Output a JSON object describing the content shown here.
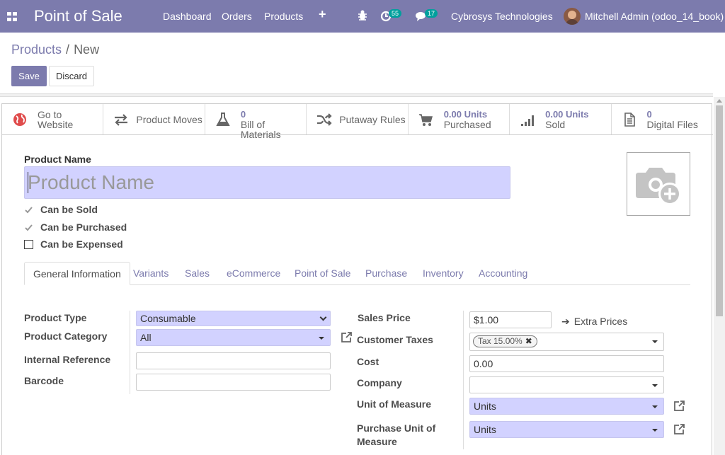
{
  "navbar": {
    "brand": "Point of Sale",
    "menu": [
      "Dashboard",
      "Orders",
      "Products"
    ],
    "plus": "+",
    "activity_badge": "55",
    "message_badge": "17",
    "company": "Cybrosys Technologies",
    "user": "Mitchell Admin (odoo_14_book)"
  },
  "breadcrumb": {
    "parent": "Products",
    "separator": "/",
    "current": "New"
  },
  "buttons": {
    "save": "Save",
    "discard": "Discard"
  },
  "smart_buttons": [
    {
      "icon": "globe-icon",
      "line1": "Go to",
      "line2": "Website"
    },
    {
      "icon": "exchange-icon",
      "label": "Product Moves"
    },
    {
      "icon": "flask-icon",
      "value": "0",
      "label": "Bill of Materials"
    },
    {
      "icon": "random-icon",
      "label": "Putaway Rules"
    },
    {
      "icon": "cart-icon",
      "value": "0.00 Units",
      "label": "Purchased"
    },
    {
      "icon": "signal-icon",
      "value": "0.00 Units",
      "label": "Sold"
    },
    {
      "icon": "file-icon",
      "value": "0",
      "label": "Digital Files"
    }
  ],
  "form": {
    "product_name_label": "Product Name",
    "product_name_placeholder": "Product Name",
    "checkboxes": [
      {
        "label": "Can be Sold",
        "checked": true
      },
      {
        "label": "Can be Purchased",
        "checked": true
      },
      {
        "label": "Can be Expensed",
        "checked": false
      }
    ]
  },
  "tabs": [
    "General Information",
    "Variants",
    "Sales",
    "eCommerce",
    "Point of Sale",
    "Purchase",
    "Inventory",
    "Accounting"
  ],
  "general_info": {
    "left": {
      "product_type_label": "Product Type",
      "product_type_value": "Consumable",
      "product_category_label": "Product Category",
      "product_category_value": "All",
      "internal_reference_label": "Internal Reference",
      "internal_reference_value": "",
      "barcode_label": "Barcode",
      "barcode_value": ""
    },
    "right": {
      "sales_price_label": "Sales Price",
      "sales_price_value": "$1.00",
      "extra_prices": "Extra Prices",
      "customer_taxes_label": "Customer Taxes",
      "customer_taxes_tag": "Tax 15.00%",
      "cost_label": "Cost",
      "cost_value": "0.00",
      "company_label": "Company",
      "company_value": "",
      "uom_label": "Unit of Measure",
      "uom_value": "Units",
      "purchase_uom_label_1": "Purchase Unit of",
      "purchase_uom_label_2": "Measure",
      "purchase_uom_value": "Units"
    }
  },
  "colors": {
    "brand": "#7c7bad",
    "required_field": "#d2d2ff",
    "badge": "#00a09d"
  }
}
